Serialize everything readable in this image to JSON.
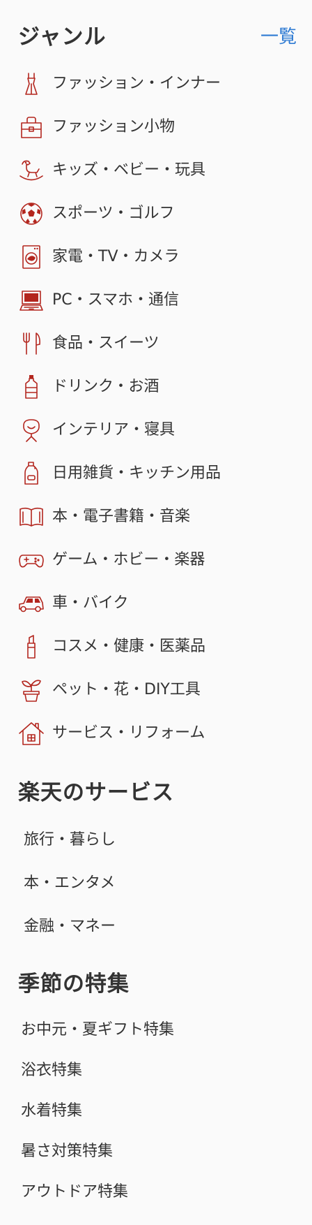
{
  "genre": {
    "title": "ジャンル",
    "list_link": "一覧",
    "items": [
      {
        "label": "ファッション・インナー",
        "icon": "dress-icon"
      },
      {
        "label": "ファッション小物",
        "icon": "handbag-icon"
      },
      {
        "label": "キッズ・ベビー・玩具",
        "icon": "rocking-horse-icon"
      },
      {
        "label": "スポーツ・ゴルフ",
        "icon": "soccer-ball-icon"
      },
      {
        "label": "家電・TV・カメラ",
        "icon": "washing-machine-icon"
      },
      {
        "label": "PC・スマホ・通信",
        "icon": "laptop-icon"
      },
      {
        "label": "食品・スイーツ",
        "icon": "fork-knife-icon"
      },
      {
        "label": "ドリンク・お酒",
        "icon": "bottle-icon"
      },
      {
        "label": "インテリア・寝具",
        "icon": "chair-icon"
      },
      {
        "label": "日用雑貨・キッチン用品",
        "icon": "detergent-bottle-icon"
      },
      {
        "label": "本・電子書籍・音楽",
        "icon": "open-book-icon"
      },
      {
        "label": "ゲーム・ホビー・楽器",
        "icon": "game-controller-icon"
      },
      {
        "label": "車・バイク",
        "icon": "car-icon"
      },
      {
        "label": "コスメ・健康・医薬品",
        "icon": "lipstick-icon"
      },
      {
        "label": "ペット・花・DIY工具",
        "icon": "potted-plant-icon"
      },
      {
        "label": "サービス・リフォーム",
        "icon": "house-icon"
      }
    ]
  },
  "services": {
    "title": "楽天のサービス",
    "items": [
      "旅行・暮らし",
      "本・エンタメ",
      "金融・マネー"
    ]
  },
  "season": {
    "title": "季節の特集",
    "items": [
      "お中元・夏ギフト特集",
      "浴衣特集",
      "水着特集",
      "暑さ対策特集",
      "アウトドア特集"
    ]
  },
  "colors": {
    "icon": "#b3261e",
    "link": "#2f7bd3",
    "text": "#333333",
    "background": "#fafafa"
  }
}
